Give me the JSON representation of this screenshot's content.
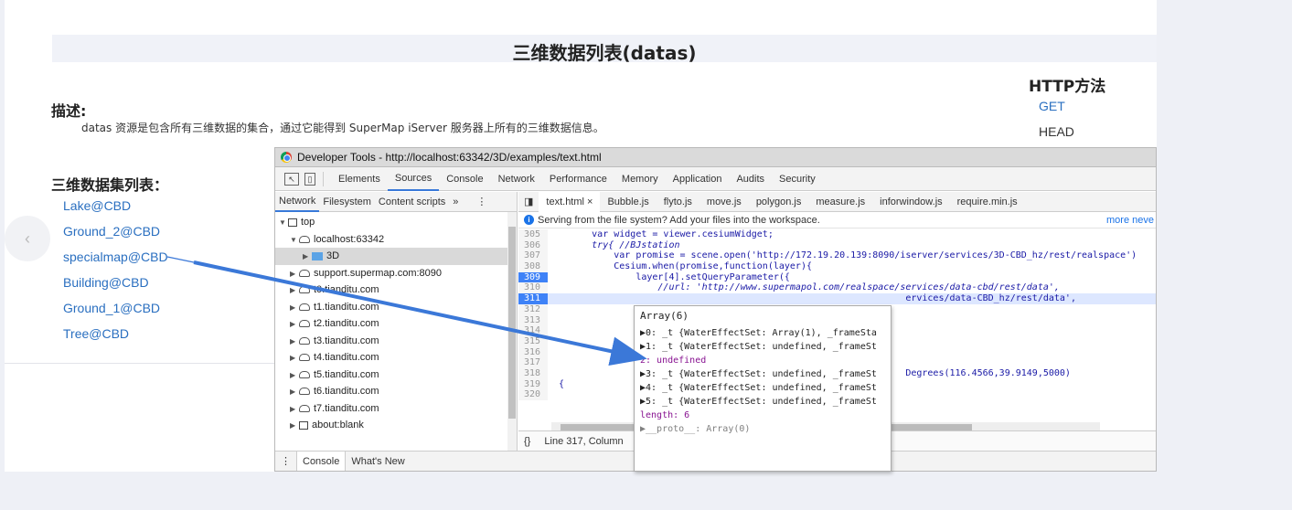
{
  "page": {
    "title": "三维数据列表(datas)",
    "description_heading": "描述:",
    "description_text": "datas 资源是包含所有三维数据的集合，通过它能得到 SuperMap iServer 服务器上所有的三维数据信息。",
    "list_heading": "三维数据集列表：",
    "datasets": [
      "Lake@CBD",
      "Ground_2@CBD",
      "specialmap@CBD",
      "Building@CBD",
      "Ground_1@CBD",
      "Tree@CBD"
    ],
    "http_heading": "HTTP方法",
    "methods": [
      "GET",
      "HEAD"
    ],
    "prev_icon": "‹"
  },
  "devtools": {
    "window_title": "Developer Tools - http://localhost:63342/3D/examples/text.html",
    "tabs": [
      "Elements",
      "Sources",
      "Console",
      "Network",
      "Performance",
      "Memory",
      "Application",
      "Audits",
      "Security"
    ],
    "navigator_tabs": [
      "Network",
      "Filesystem",
      "Content scripts",
      "»"
    ],
    "tree": [
      "top",
      "localhost:63342",
      "3D",
      "support.supermap.com:8090",
      "t0.tianditu.com",
      "t1.tianditu.com",
      "t2.tianditu.com",
      "t3.tianditu.com",
      "t4.tianditu.com",
      "t5.tianditu.com",
      "t6.tianditu.com",
      "t7.tianditu.com",
      "about:blank"
    ],
    "editor_tabs": [
      "text.html ×",
      "Bubble.js",
      "flyto.js",
      "move.js",
      "polygon.js",
      "measure.js",
      "inforwindow.js",
      "require.min.js"
    ],
    "info_text": "Serving from the file system? Add your files into the workspace.",
    "info_more": "more neve",
    "code_lines": [
      {
        "n": "305",
        "t": "        var widget = viewer.cesiumWidget;"
      },
      {
        "n": "306",
        "t": "        try{ //BJstation"
      },
      {
        "n": "307",
        "t": "            var promise = scene.open('http://172.19.20.139:8090/iserver/services/3D-CBD_hz/rest/realspace')"
      },
      {
        "n": "308",
        "t": "            Cesium.when(promise,function(layer){"
      },
      {
        "n": "309",
        "t": "                layer[4].setQueryParameter({"
      },
      {
        "n": "310",
        "t": "                    //url: 'http://www.supermapol.com/realspace/services/data-cbd/rest/data',"
      },
      {
        "n": "311",
        "t": "                                                                 ervices/data-CBD_hz/rest/data',"
      },
      {
        "n": "312",
        "t": ""
      },
      {
        "n": "313",
        "t": ""
      },
      {
        "n": "314",
        "t": ""
      },
      {
        "n": "315",
        "t": ""
      },
      {
        "n": "316",
        "t": ""
      },
      {
        "n": "317",
        "t": ""
      },
      {
        "n": "318",
        "t": "                                                                 Degrees(116.4566,39.9149,5000)"
      },
      {
        "n": "319",
        "t": "  {"
      },
      {
        "n": "320",
        "t": ""
      }
    ],
    "status_text": "Line 317, Column",
    "drawer_tabs": [
      "Console",
      "What's New"
    ],
    "popup": {
      "header": "Array(6)",
      "rows": [
        "▶0: _t {WaterEffectSet: Array(1), _frameSta",
        "▶1: _t {WaterEffectSet: undefined, _frameSt",
        "  2: undefined",
        "▶3: _t {WaterEffectSet: undefined, _frameSt",
        "▶4: _t {WaterEffectSet: undefined, _frameSt",
        "▶5: _t {WaterEffectSet: undefined, _frameSt",
        "  length: 6",
        "▶__proto__: Array(0)"
      ]
    }
  }
}
